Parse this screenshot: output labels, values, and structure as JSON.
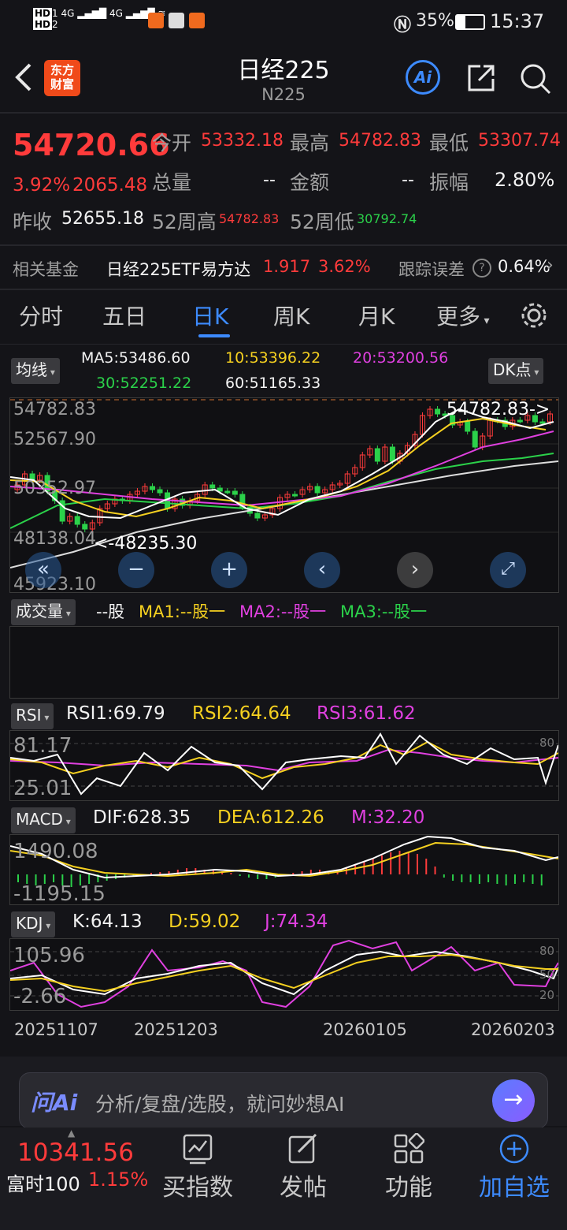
{
  "status_bar": {
    "network": "4G",
    "battery": "35%",
    "time": "15:37"
  },
  "header": {
    "logo_line1": "东方",
    "logo_line2": "财富",
    "title": "日经225",
    "subtitle": "N225",
    "ai_label": "Ai"
  },
  "quote": {
    "price": "54720.66",
    "change_pct": "3.92%",
    "change": "2065.48",
    "open_label": "今开",
    "open": "53332.18",
    "high_label": "最高",
    "high": "54782.83",
    "low_label": "最低",
    "low": "53307.74",
    "volume_label": "总量",
    "volume": "--",
    "amount_label": "金额",
    "amount": "--",
    "amplitude_label": "振幅",
    "amplitude": "2.80%",
    "prev_close_label": "昨收",
    "prev_close": "52655.18",
    "w52_high_label": "52周高",
    "w52_high": "54782.83",
    "w52_low_label": "52周低",
    "w52_low": "30792.74"
  },
  "fund": {
    "label": "相关基金",
    "name": "日经225ETF易方达",
    "price": "1.917",
    "pct": "3.62%",
    "err_label": "跟踪误差",
    "err_value": "0.64%"
  },
  "tabs": [
    {
      "label": "分时"
    },
    {
      "label": "五日"
    },
    {
      "label": "日K"
    },
    {
      "label": "周K"
    },
    {
      "label": "月K"
    },
    {
      "label": "更多"
    }
  ],
  "ma": {
    "dropdown": "均线",
    "ma5": "MA5:53486.60",
    "ma10": "10:53396.22",
    "ma20": "20:53200.56",
    "ma30": "30:52251.22",
    "ma60": "60:51165.33",
    "dk": "DK点"
  },
  "kchart": {
    "y_labels": [
      "54782.83",
      "52567.90",
      "50352.97",
      "48138.04",
      "45923.10"
    ],
    "max_tag": "54782.83->",
    "min_tag": "<-48235.30"
  },
  "volume": {
    "dropdown": "成交量",
    "unit": "--股",
    "ma1": "MA1:--股一",
    "ma2": "MA2:--股一",
    "ma3": "MA3:--股一"
  },
  "rsi": {
    "dropdown": "RSI",
    "rsi1": "RSI1:69.79",
    "rsi2": "RSI2:64.64",
    "rsi3": "RSI3:61.62",
    "y_top": "81.17",
    "y_bottom": "25.01",
    "right_label": "80"
  },
  "macd": {
    "dropdown": "MACD",
    "dif": "DIF:628.35",
    "dea": "DEA:612.26",
    "m": "M:32.20",
    "y_top": "1490.08",
    "y_bottom": "-1195.15"
  },
  "kdj": {
    "dropdown": "KDJ",
    "k": "K:64.13",
    "d": "D:59.02",
    "j": "J:74.34",
    "y_top": "105.96",
    "y_bottom": "-2.66",
    "r80": "80",
    "r50": "50",
    "r20": "20"
  },
  "dates": [
    "20251107",
    "20251203",
    "20260105",
    "20260203"
  ],
  "ai_bar": {
    "brand": "问Ai",
    "placeholder": "分析/复盘/选股，就问妙想AI"
  },
  "bottom_nav": {
    "index_value": "10341.56",
    "index_name": "富时100",
    "index_pct": "1.15%",
    "buy_index": "买指数",
    "post": "发帖",
    "features": "功能",
    "add_watch": "加自选"
  },
  "colors": {
    "up": "#ff3b3b",
    "down": "#2bd14a",
    "accent_blue": "#3d8bff"
  }
}
